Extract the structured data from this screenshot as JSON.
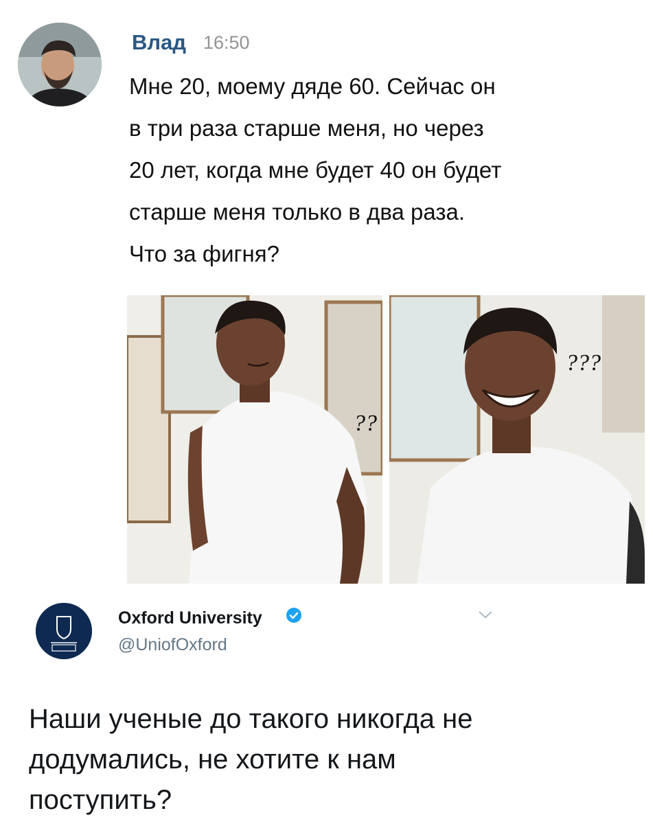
{
  "vk_post": {
    "author": "Влад",
    "time": "16:50",
    "text": "Мне 20, моему дяде 60. Сейчас он\nв три раза старше меня, но через\n20 лет, когда мне будет 40 он будет\nстарше меня только в два раза.\nЧто за фигня?",
    "meme": {
      "left_caption": "??",
      "right_caption": "???"
    }
  },
  "tweet": {
    "name": "Oxford University",
    "handle": "@UniofOxford",
    "verified": true,
    "text": "Наши ученые до такого никогда не\nдодумались, не хотите к нам\nпоступить?",
    "icons": {
      "verified": "verified-badge-icon",
      "menu": "chevron-down-icon"
    },
    "colors": {
      "verified": "#1da1f2",
      "oxford_blue": "#0e2a52"
    }
  },
  "colors": {
    "vk_name": "#2a5885",
    "time": "#939393",
    "handle": "#657786"
  }
}
